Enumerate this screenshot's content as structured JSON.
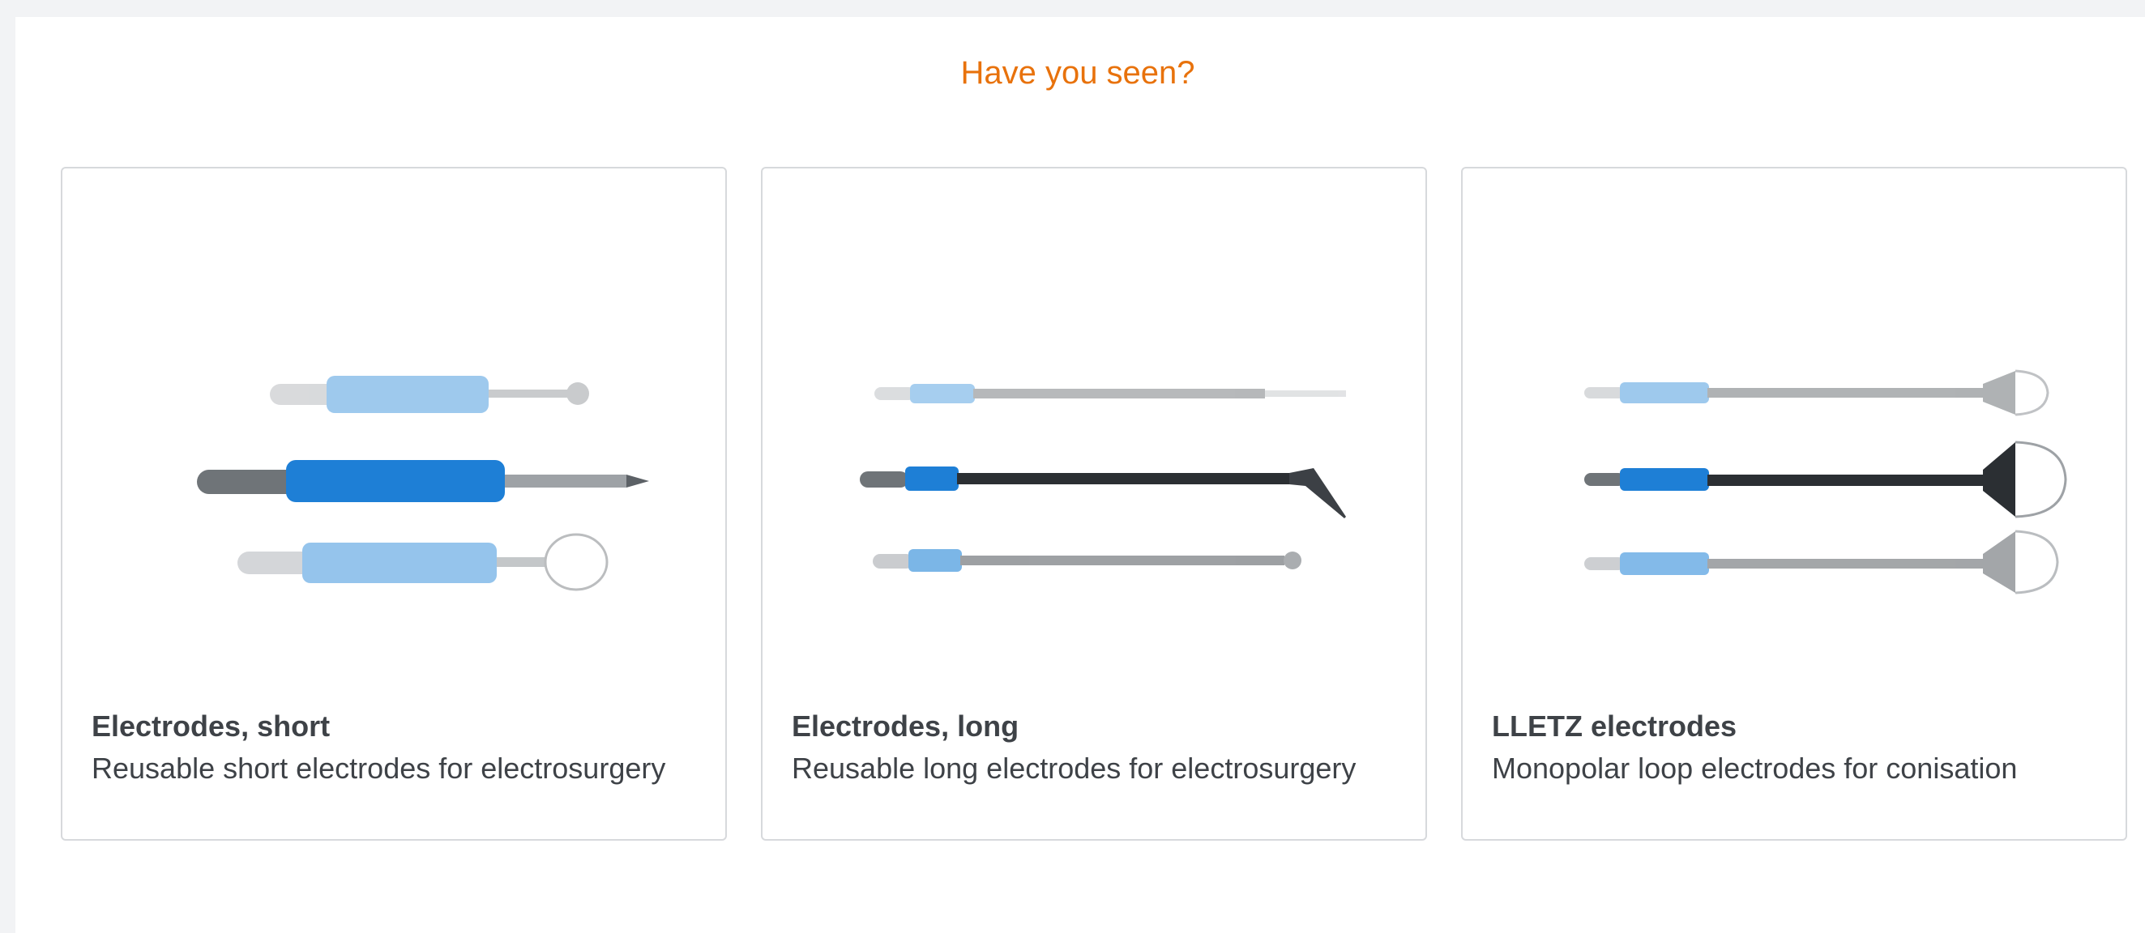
{
  "section": {
    "heading": "Have you seen?"
  },
  "cards": [
    {
      "title": "Electrodes, short",
      "description": "Reusable short electrodes for electrosurgery",
      "image_icon": "short-electrodes-product-image"
    },
    {
      "title": "Electrodes, long",
      "description": "Reusable long electrodes for electrosurgery",
      "image_icon": "long-electrodes-product-image"
    },
    {
      "title": "LLETZ electrodes",
      "description": "Monopolar loop electrodes for conisation",
      "image_icon": "lletz-electrodes-product-image"
    }
  ],
  "colors": {
    "accent": "#e8720c",
    "text": "#3e4247",
    "card_border": "#d7d9dc",
    "page_bg": "#f2f3f5",
    "electrode_blue": "#1e7fd6",
    "electrode_light_blue": "#8cc3ee"
  }
}
